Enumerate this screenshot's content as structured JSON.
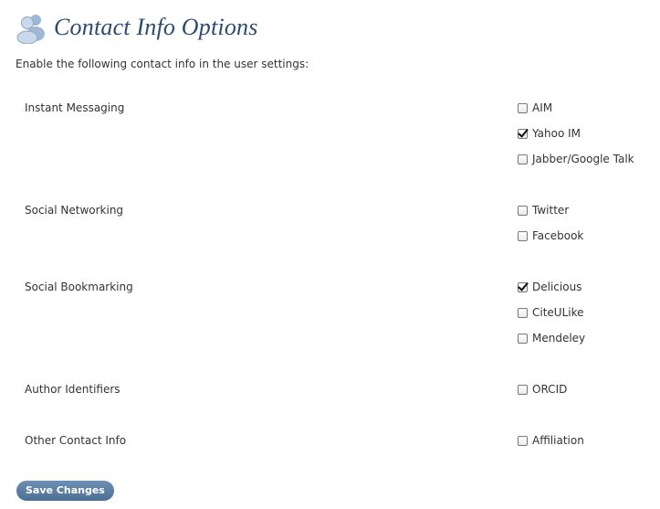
{
  "page": {
    "title": "Contact Info Options",
    "intro": "Enable the following contact info in the user settings:"
  },
  "sections": [
    {
      "label": "Instant Messaging",
      "options": [
        {
          "label": "AIM",
          "checked": false
        },
        {
          "label": "Yahoo IM",
          "checked": true
        },
        {
          "label": "Jabber/Google Talk",
          "checked": false
        }
      ]
    },
    {
      "label": "Social Networking",
      "options": [
        {
          "label": "Twitter",
          "checked": false
        },
        {
          "label": "Facebook",
          "checked": false
        }
      ]
    },
    {
      "label": "Social Bookmarking",
      "options": [
        {
          "label": "Delicious",
          "checked": true
        },
        {
          "label": "CiteULike",
          "checked": false
        },
        {
          "label": "Mendeley",
          "checked": false
        }
      ]
    },
    {
      "label": "Author Identifiers",
      "options": [
        {
          "label": "ORCID",
          "checked": false
        }
      ]
    },
    {
      "label": "Other Contact Info",
      "options": [
        {
          "label": "Affiliation",
          "checked": false
        }
      ]
    }
  ],
  "actions": {
    "save_label": "Save Changes"
  },
  "icons": {
    "header": "users-icon"
  },
  "colors": {
    "title": "#2b4c6f",
    "button": "#5a7ea3"
  }
}
